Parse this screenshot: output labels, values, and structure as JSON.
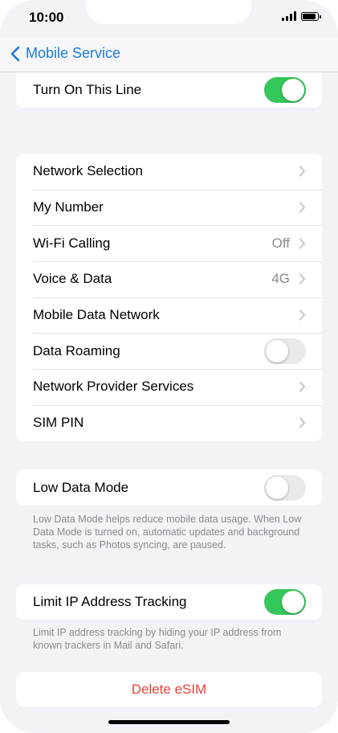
{
  "status_bar": {
    "time": "10:00"
  },
  "nav": {
    "back_label": "Mobile Service"
  },
  "top_group": {
    "turn_on_line": {
      "label": "Turn On This Line",
      "enabled": true
    }
  },
  "network_group": {
    "network_selection": {
      "label": "Network Selection"
    },
    "my_number": {
      "label": "My Number"
    },
    "wifi_calling": {
      "label": "Wi-Fi Calling",
      "value": "Off"
    },
    "voice_data": {
      "label": "Voice & Data",
      "value": "4G"
    },
    "mobile_data_network": {
      "label": "Mobile Data Network"
    },
    "data_roaming": {
      "label": "Data Roaming",
      "enabled": false
    },
    "network_provider_services": {
      "label": "Network Provider Services"
    },
    "sim_pin": {
      "label": "SIM PIN"
    }
  },
  "low_data_group": {
    "low_data_mode": {
      "label": "Low Data Mode",
      "enabled": false
    },
    "footnote": "Low Data Mode helps reduce mobile data usage. When Low Data Mode is turned on, automatic updates and background tasks, such as Photos syncing, are paused."
  },
  "ip_group": {
    "limit_ip": {
      "label": "Limit IP Address Tracking",
      "enabled": true
    },
    "footnote": "Limit IP address tracking by hiding your IP address from known trackers in Mail and Safari."
  },
  "delete_group": {
    "label": "Delete eSIM"
  },
  "colors": {
    "accent": "#1b7ae0",
    "toggle_on": "#34c759",
    "destructive": "#e5423a",
    "background": "#f2f2f7"
  }
}
